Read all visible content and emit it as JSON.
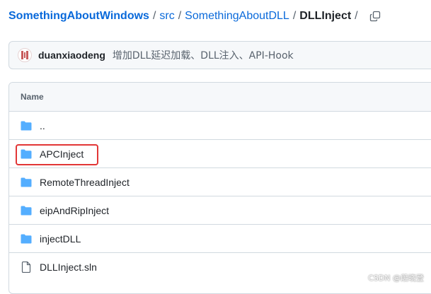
{
  "breadcrumb": {
    "repo": "SomethingAboutWindows",
    "sep": "/",
    "path1": "src",
    "path2": "SomethingAboutDLL",
    "current": "DLLInject",
    "trailing_sep": "/"
  },
  "icons": {
    "copy": "copy-icon",
    "folder": "folder-icon",
    "file": "file-icon",
    "avatar": "avatar-icon"
  },
  "colors": {
    "link": "#0969da",
    "folder": "#54aeff",
    "highlight": "#e23636"
  },
  "commit": {
    "author": "duanxiaodeng",
    "message": "增加DLL延迟加载、DLL注入、API-Hook"
  },
  "table": {
    "header": "Name",
    "rows": [
      {
        "name": "..",
        "type": "parent"
      },
      {
        "name": "APCInject",
        "type": "folder",
        "highlighted": true
      },
      {
        "name": "RemoteThreadInject",
        "type": "folder"
      },
      {
        "name": "eipAndRipInject",
        "type": "folder"
      },
      {
        "name": "injectDLL",
        "type": "folder"
      },
      {
        "name": "DLLInject.sln",
        "type": "file"
      }
    ]
  },
  "watermark": "CSDN @段晓登"
}
